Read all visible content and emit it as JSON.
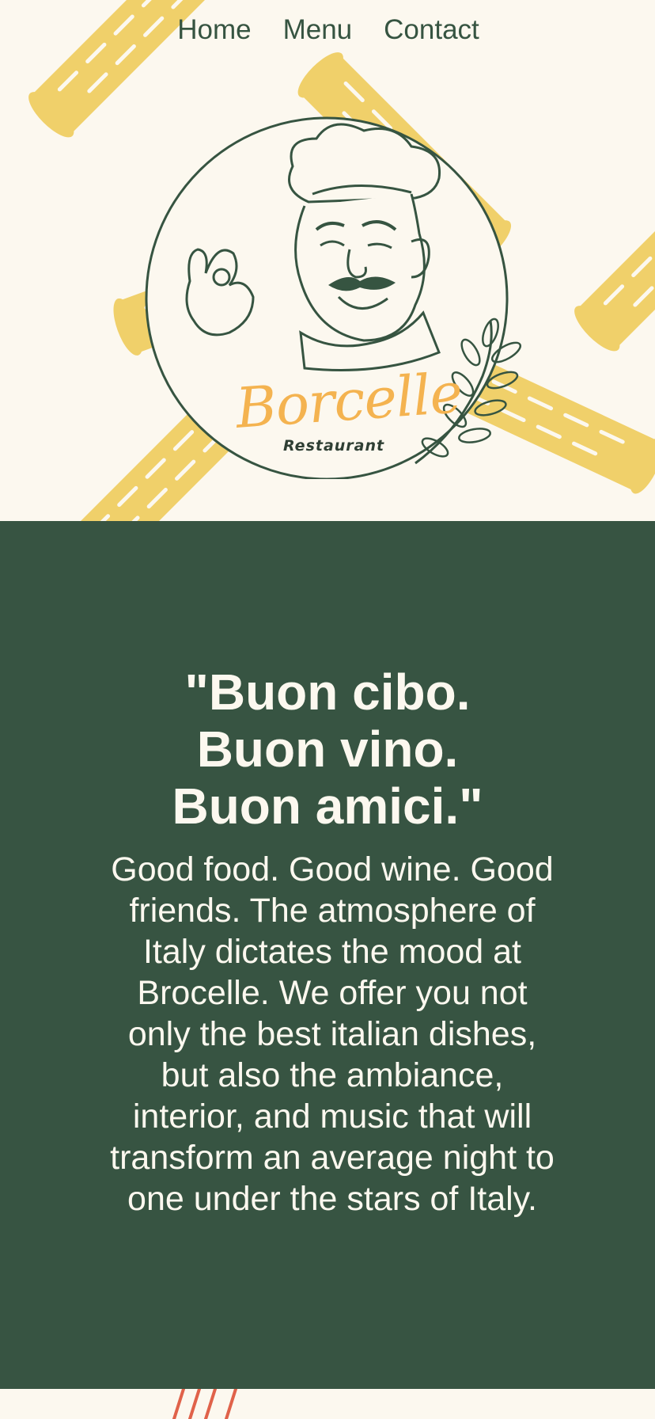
{
  "nav": {
    "items": [
      {
        "label": "Home"
      },
      {
        "label": "Menu"
      },
      {
        "label": "Contact"
      }
    ]
  },
  "brand": {
    "name": "Borcelle",
    "subtitle": "Restaurant"
  },
  "about": {
    "heading_lines": [
      "\"Buon cibo.",
      "Buon vino.",
      "Buon amici.\""
    ],
    "body": "Good food. Good wine. Good friends. The atmosphere of Italy dictates the mood at Brocelle. We offer you not only the best italian dishes, but also the ambiance, interior, and music that will transform an average night to one under the stars of Italy."
  },
  "colors": {
    "cream": "#fcf8ef",
    "forest_green": "#375442",
    "pasta_yellow": "#f0d06a",
    "brand_orange": "#f4b350",
    "accent_red": "#e0624a"
  },
  "icons": [
    "chef-logo-illustration",
    "olive-branch-icon",
    "penne-pasta-decoration"
  ]
}
